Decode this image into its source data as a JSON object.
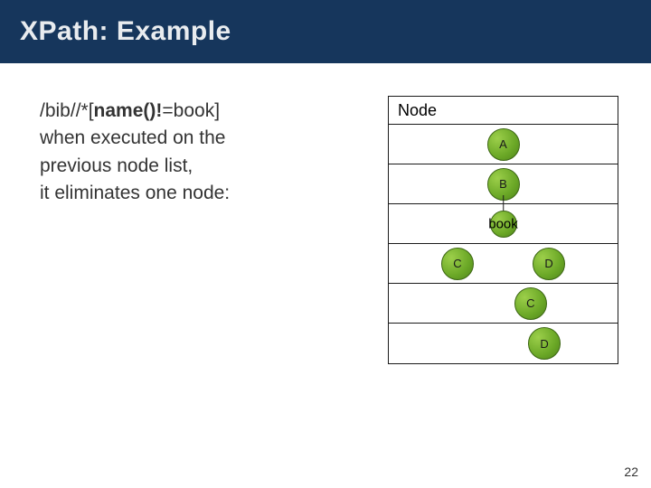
{
  "slide": {
    "title": "XPath: Example",
    "pageNumber": "22"
  },
  "text": {
    "xpathPrefix": "/bib//*[",
    "xpathBold": "name()!",
    "xpathSuffix": "=book]",
    "line2": "when executed on the",
    "line3": "previous node list,",
    "line4": "it eliminates one node:"
  },
  "table": {
    "header": "Node",
    "rows": [
      {
        "nodes": [
          {
            "label": "A",
            "pos": 50
          }
        ]
      },
      {
        "nodes": [
          {
            "label": "B",
            "pos": 50
          }
        ],
        "arrowDown": true
      },
      {
        "bookLabel": "book",
        "bookCircle": true
      },
      {
        "nodes": [
          {
            "label": "C",
            "pos": 30
          },
          {
            "label": "D",
            "pos": 70
          }
        ]
      },
      {
        "nodes": [
          {
            "label": "C",
            "pos": 62
          }
        ]
      },
      {
        "nodes": [
          {
            "label": "D",
            "pos": 68
          }
        ]
      }
    ]
  }
}
